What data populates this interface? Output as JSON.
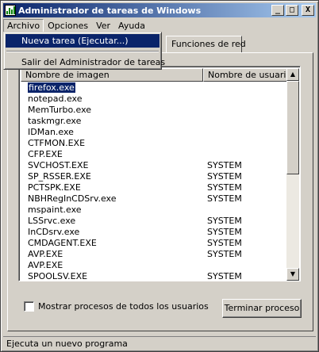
{
  "window": {
    "title": "Administrador de tareas de Windows"
  },
  "caption_buttons": {
    "minimize": "_",
    "maximize": "□",
    "close": "X"
  },
  "menubar": {
    "items": [
      {
        "label": "Archivo"
      },
      {
        "label": "Opciones"
      },
      {
        "label": "Ver"
      },
      {
        "label": "Ayuda"
      }
    ]
  },
  "dropdown": {
    "items": [
      {
        "label": "Nueva tarea (Ejecutar...)"
      },
      {
        "label": "Salir del Administrador de tareas"
      }
    ]
  },
  "tabs": {
    "visible_label": "Funciones de red"
  },
  "list": {
    "columns": [
      "Nombre de imagen",
      "Nombre de usuario"
    ],
    "rows": [
      {
        "name": "firefox.exe",
        "user": ""
      },
      {
        "name": "notepad.exe",
        "user": ""
      },
      {
        "name": "MemTurbo.exe",
        "user": ""
      },
      {
        "name": "taskmgr.exe",
        "user": ""
      },
      {
        "name": "IDMan.exe",
        "user": ""
      },
      {
        "name": "CTFMON.EXE",
        "user": ""
      },
      {
        "name": "CFP.EXE",
        "user": ""
      },
      {
        "name": "SVCHOST.EXE",
        "user": "SYSTEM"
      },
      {
        "name": "SP_RSSER.EXE",
        "user": "SYSTEM"
      },
      {
        "name": "PCTSPK.EXE",
        "user": "SYSTEM"
      },
      {
        "name": "NBHRegInCDSrv.exe",
        "user": "SYSTEM"
      },
      {
        "name": "mspaint.exe",
        "user": ""
      },
      {
        "name": "LSSrvc.exe",
        "user": "SYSTEM"
      },
      {
        "name": "InCDsrv.exe",
        "user": "SYSTEM"
      },
      {
        "name": "CMDAGENT.EXE",
        "user": "SYSTEM"
      },
      {
        "name": "AVP.EXE",
        "user": "SYSTEM"
      },
      {
        "name": "AVP.EXE",
        "user": ""
      },
      {
        "name": "SPOOLSV.EXE",
        "user": "SYSTEM"
      }
    ],
    "selected_index": 0
  },
  "scrollbar": {
    "up_glyph": "▲",
    "down_glyph": "▼"
  },
  "show_all_users": {
    "label": "Mostrar procesos de todos los usuarios",
    "checked": false
  },
  "end_process_button": {
    "label": "Terminar proceso"
  },
  "statusbar": {
    "text": "Ejecuta un nuevo programa"
  },
  "colors": {
    "titlebar_start": "#0a246a",
    "titlebar_end": "#a6caf0",
    "selection": "#0a246a",
    "face": "#d4d0c8"
  }
}
